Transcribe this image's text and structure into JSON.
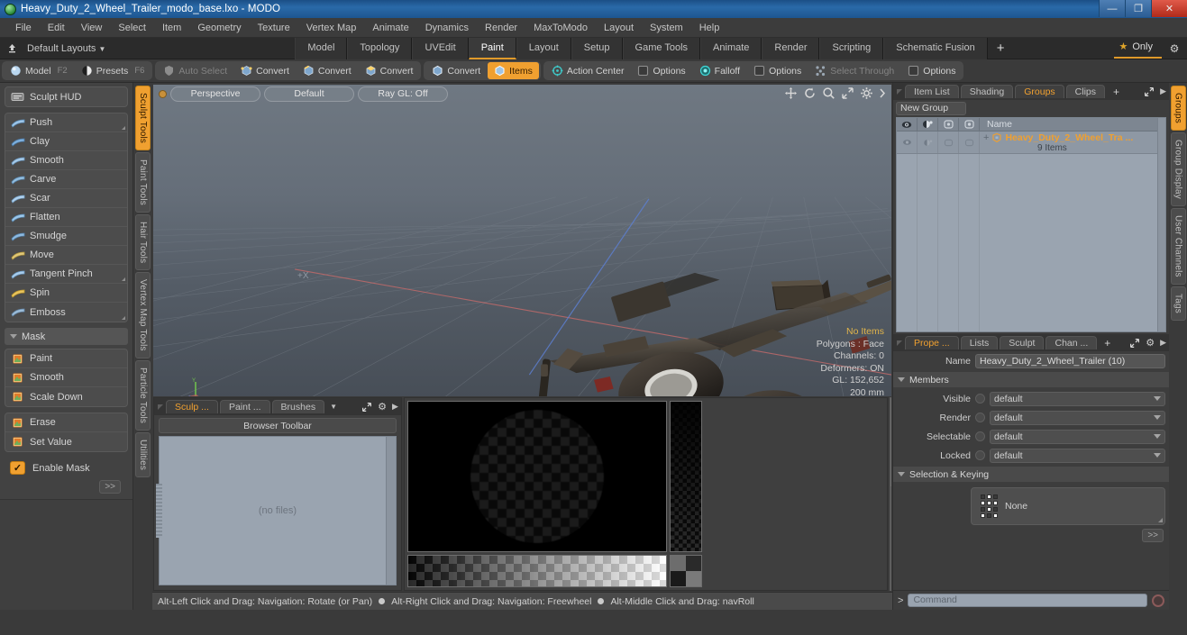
{
  "window": {
    "title": "Heavy_Duty_2_Wheel_Trailer_modo_base.lxo - MODO",
    "minimize": "—",
    "maximize": "❐",
    "close": "✕"
  },
  "menubar": [
    "File",
    "Edit",
    "View",
    "Select",
    "Item",
    "Geometry",
    "Texture",
    "Vertex Map",
    "Animate",
    "Dynamics",
    "Render",
    "MaxToModo",
    "Layout",
    "System",
    "Help"
  ],
  "layout_row": {
    "preset_label": "Default Layouts",
    "tabs": [
      {
        "label": "Model",
        "active": false
      },
      {
        "label": "Topology",
        "active": false
      },
      {
        "label": "UVEdit",
        "active": false
      },
      {
        "label": "Paint",
        "active": true
      },
      {
        "label": "Layout",
        "active": false
      },
      {
        "label": "Setup",
        "active": false
      },
      {
        "label": "Game Tools",
        "active": false
      },
      {
        "label": "Animate",
        "active": false
      },
      {
        "label": "Render",
        "active": false
      },
      {
        "label": "Scripting",
        "active": false
      },
      {
        "label": "Schematic Fusion",
        "active": false
      }
    ],
    "add": "+",
    "only_label": "Only"
  },
  "toolbar": {
    "group1": [
      {
        "label": "Model",
        "key": "F2",
        "icon": "sphere-icon",
        "active": false,
        "dim": false
      },
      {
        "label": "Presets",
        "key": "F6",
        "icon": "halfsphere-icon",
        "active": false,
        "dim": false
      }
    ],
    "group2": [
      {
        "label": "Auto Select",
        "icon": "shield-icon",
        "active": false,
        "dim": true
      },
      {
        "label": "Convert",
        "icon": "vertex-icon",
        "active": false,
        "dim": false
      },
      {
        "label": "Convert",
        "icon": "edge-icon",
        "active": false,
        "dim": false
      },
      {
        "label": "Convert",
        "icon": "polygon-icon",
        "active": false,
        "dim": false
      }
    ],
    "group3": [
      {
        "label": "Convert",
        "icon": "item-icon",
        "active": false,
        "dim": false
      },
      {
        "label": "Items",
        "icon": "items-icon",
        "active": true,
        "dim": false
      }
    ],
    "group4": [
      {
        "label": "Action Center",
        "icon": "action-center-icon",
        "active": false,
        "dim": false
      },
      {
        "label": "Options",
        "icon": "checkbox-icon",
        "active": false,
        "dim": false
      },
      {
        "label": "Falloff",
        "icon": "falloff-icon",
        "active": false,
        "dim": false
      },
      {
        "label": "Options",
        "icon": "checkbox-icon",
        "active": false,
        "dim": false
      },
      {
        "label": "Select Through",
        "icon": "select-through-icon",
        "active": false,
        "dim": true
      },
      {
        "label": "Options",
        "icon": "checkbox-icon",
        "active": false,
        "dim": false
      }
    ]
  },
  "left_panel": {
    "hud_button": "Sculpt HUD",
    "sculpt_tools": [
      {
        "label": "Push",
        "corner": true
      },
      {
        "label": "Clay",
        "corner": false
      },
      {
        "label": "Smooth",
        "corner": false
      },
      {
        "label": "Carve",
        "corner": false
      },
      {
        "label": "Scar",
        "corner": false
      },
      {
        "label": "Flatten",
        "corner": false
      },
      {
        "label": "Smudge",
        "corner": false
      },
      {
        "label": "Move",
        "corner": false
      },
      {
        "label": "Tangent Pinch",
        "corner": true
      },
      {
        "label": "Spin",
        "corner": false
      },
      {
        "label": "Emboss",
        "corner": true
      }
    ],
    "mask_header": "Mask",
    "mask_tools": [
      {
        "label": "Paint"
      },
      {
        "label": "Smooth"
      },
      {
        "label": "Scale Down"
      }
    ],
    "mask_tools2": [
      {
        "label": "Erase"
      },
      {
        "label": "Set Value"
      }
    ],
    "enable_mask": "Enable Mask",
    "expand": ">>",
    "vertical_tabs": [
      {
        "label": "Sculpt Tools",
        "active": true
      },
      {
        "label": "Paint Tools",
        "active": false
      },
      {
        "label": "Hair Tools",
        "active": false
      },
      {
        "label": "Vertex Map Tools",
        "active": false
      },
      {
        "label": "Particle Tools",
        "active": false
      },
      {
        "label": "Utilities",
        "active": false
      }
    ]
  },
  "viewport": {
    "mode": "Perspective",
    "shading": "Default",
    "raygl": "Ray GL: Off",
    "info": {
      "items": "No Items",
      "polygons": "Polygons : Face",
      "channels": "Channels: 0",
      "deformers": "Deformers: ON",
      "gl": "GL: 152,652",
      "scale": "200 mm"
    },
    "axis_x_label": "+X",
    "icons": [
      "pan-icon",
      "rotate-icon",
      "zoom-icon",
      "maximize-icon",
      "gear-icon",
      "chevron-right-icon"
    ]
  },
  "bottom_panel": {
    "tabs": [
      {
        "label": "Sculp ...",
        "active": true
      },
      {
        "label": "Paint ...",
        "active": false
      },
      {
        "label": "Brushes",
        "active": false
      }
    ],
    "browser_toolbar": "Browser Toolbar",
    "no_files": "(no files)"
  },
  "statusbar": {
    "parts": [
      "Alt-Left Click and Drag: Navigation: Rotate (or Pan)",
      "Alt-Right Click and Drag: Navigation: Freewheel",
      "Alt-Middle Click and Drag: navRoll"
    ]
  },
  "right_panel": {
    "tabs": [
      {
        "label": "Item List",
        "active": false
      },
      {
        "label": "Shading",
        "active": false
      },
      {
        "label": "Groups",
        "active": true
      },
      {
        "label": "Clips",
        "active": false
      }
    ],
    "add": "+",
    "new_group": "New Group",
    "tree_columns": [
      "eye-icon",
      "render-icon",
      "lock-icon",
      "info-icon"
    ],
    "name_column": "Name",
    "tree_rows": [
      {
        "name": "Heavy_Duty_2_Wheel_Tra ...",
        "sub": "9 Items",
        "plus": "+"
      }
    ],
    "prop_tabs": [
      {
        "label": "Prope ...",
        "active": true
      },
      {
        "label": "Lists",
        "active": false
      },
      {
        "label": "Sculpt",
        "active": false
      },
      {
        "label": "Chan ...",
        "active": false
      }
    ],
    "prop_add": "+",
    "name_label": "Name",
    "name_value": "Heavy_Duty_2_Wheel_Trailer (10)",
    "members_header": "Members",
    "members": [
      {
        "label": "Visible",
        "value": "default"
      },
      {
        "label": "Render",
        "value": "default"
      },
      {
        "label": "Selectable",
        "value": "default"
      },
      {
        "label": "Locked",
        "value": "default"
      }
    ],
    "selection_header": "Selection & Keying",
    "keying_value": "None",
    "expand": ">>",
    "vertical_tabs": [
      {
        "label": "Groups",
        "active": true
      },
      {
        "label": "Group Display",
        "active": false
      },
      {
        "label": "User Channels",
        "active": false
      },
      {
        "label": "Tags",
        "active": false
      }
    ]
  },
  "command": {
    "prompt": ">",
    "placeholder": "Command"
  },
  "colors": {
    "accent": "#f0a030",
    "titlebar": "#1d5590",
    "panel": "#3d3d3d",
    "list_bg": "#9aa4b0"
  }
}
